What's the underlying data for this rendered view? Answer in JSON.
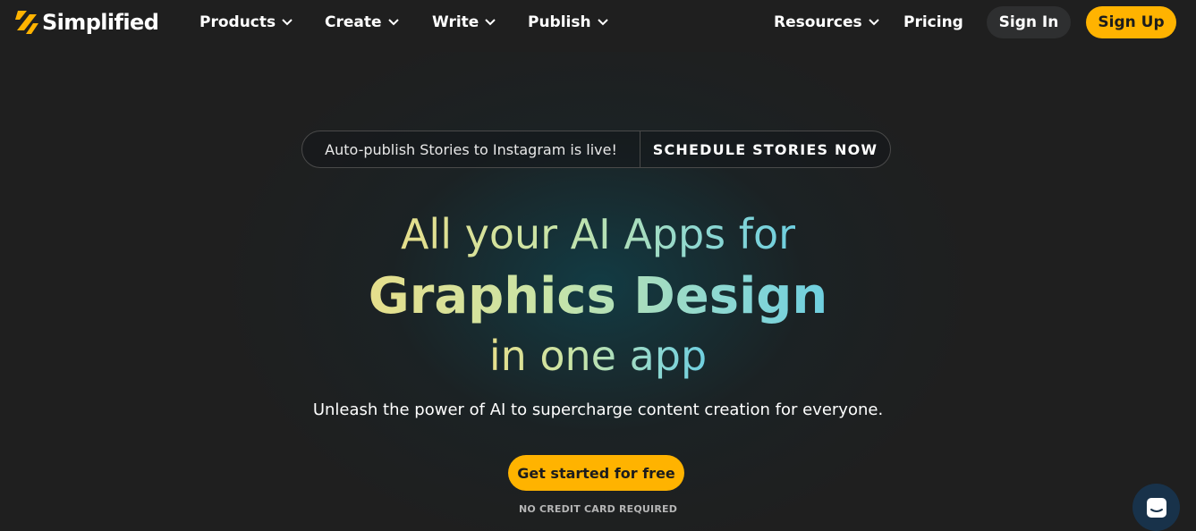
{
  "brand": {
    "name": "Simplified"
  },
  "nav": {
    "items": [
      {
        "label": "Products",
        "has_dropdown": true
      },
      {
        "label": "Create",
        "has_dropdown": true
      },
      {
        "label": "Write",
        "has_dropdown": true
      },
      {
        "label": "Publish",
        "has_dropdown": true
      },
      {
        "label": "Resources",
        "has_dropdown": true
      },
      {
        "label": "Pricing",
        "has_dropdown": false
      }
    ],
    "sign_in": "Sign In",
    "sign_up": "Sign Up"
  },
  "announcement": {
    "text": "Auto-publish Stories to Instagram is live!",
    "cta": "SCHEDULE STORIES NOW"
  },
  "hero": {
    "line1": "All your AI Apps for",
    "line2": "Graphics Design",
    "line3": "in one app",
    "subtitle": "Unleash the power of AI to supercharge content creation for everyone.",
    "cta": "Get started for free",
    "note": "NO CREDIT CARD REQUIRED"
  },
  "colors": {
    "background": "#1f1f1f",
    "accent": "#ffb300",
    "gradient_start": "#e6df8c",
    "gradient_end": "#6fcfe0"
  },
  "icons": [
    "simplified-logo-icon",
    "chevron-down-icon",
    "chat-icon"
  ]
}
